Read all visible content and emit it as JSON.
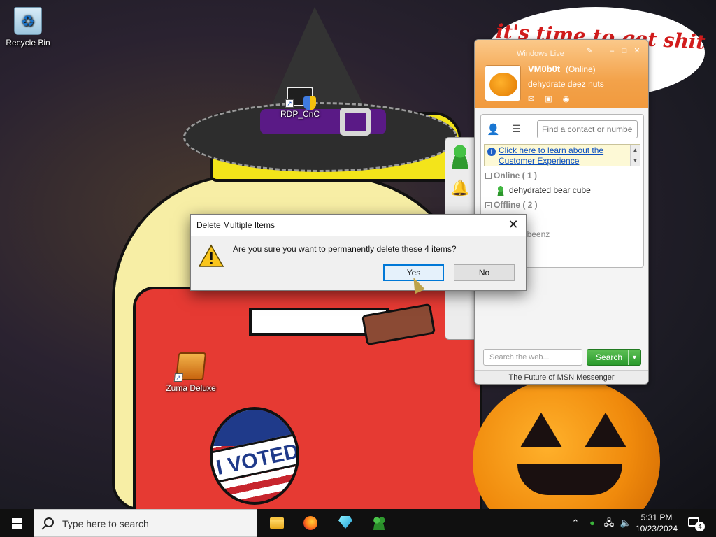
{
  "wallpaper": {
    "speech_bubble_text": "it's time to get shit ... rick ... e!",
    "sticker_text": "I VOTED"
  },
  "desktop_icons": [
    {
      "label": "Recycle Bin",
      "icon": "recycle-bin-icon"
    },
    {
      "label": "RDP_CnC",
      "icon": "remote-desktop-icon"
    },
    {
      "label": "Zuma Deluxe",
      "icon": "zuma-deluxe-icon"
    }
  ],
  "messenger": {
    "title": "Windows Live",
    "username": "VM0b0t",
    "status": "(Online)",
    "personal_message": "dehydrate deez nuts",
    "find_placeholder": "Find a contact or numbe",
    "banner_link": "Click here to learn about the Customer Experience",
    "groups": [
      {
        "label": "Online ( 1 )",
        "contacts": [
          "dehydrated bear cube"
        ]
      },
      {
        "label": "Offline ( 2 )",
        "contacts": [
          "ws111 - beenz"
        ]
      }
    ],
    "web_search_placeholder": "Search the web...",
    "search_button": "Search",
    "footer": "The Future of MSN Messenger",
    "accent_color": "#f3a24a"
  },
  "dialog": {
    "title": "Delete Multiple Items",
    "message": "Are you sure you want to permanently delete these 4 items?",
    "yes_label": "Yes",
    "no_label": "No",
    "icon": "warning-icon"
  },
  "taskbar": {
    "search_placeholder": "Type here to search",
    "pinned_apps": [
      "file-explorer",
      "firefox",
      "gem-app",
      "windows-live-messenger"
    ],
    "clock_time": "5:31 PM",
    "clock_date": "10/23/2024",
    "notification_count": "4"
  }
}
